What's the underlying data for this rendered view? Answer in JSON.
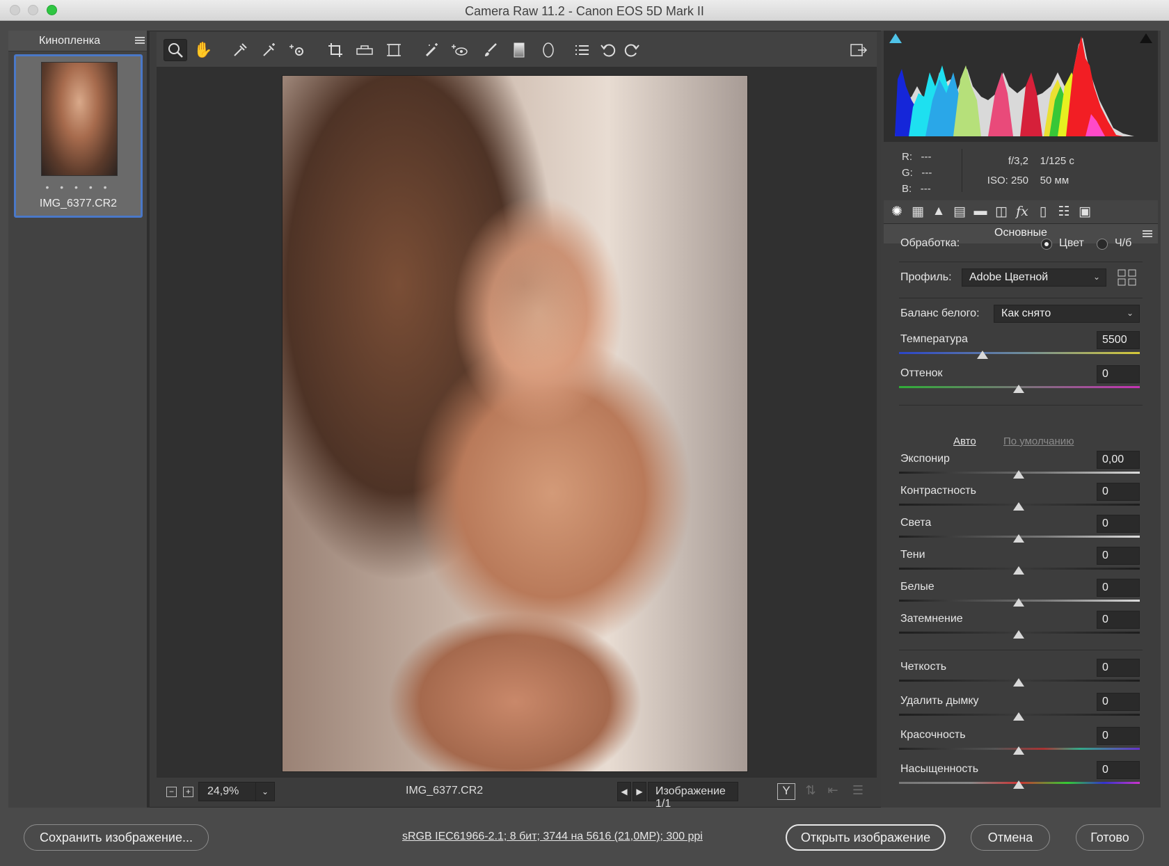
{
  "window": {
    "title": "Camera Raw 11.2  -  Canon EOS 5D Mark II"
  },
  "filmstrip": {
    "title": "Кинопленка",
    "rating_dots": "• • • • •",
    "file_name": "IMG_6377.CR2"
  },
  "toolbar": {
    "tools": [
      "zoom-icon",
      "hand-icon",
      "white-balance-icon",
      "color-sampler-icon",
      "targeted-adjustment-icon",
      "crop-icon",
      "straighten-icon",
      "transform-icon",
      "spot-removal-icon",
      "red-eye-icon",
      "adjustment-brush-icon",
      "graduated-filter-icon",
      "radial-filter-icon",
      "presets-list-icon",
      "rotate-left-icon",
      "rotate-right-icon"
    ],
    "active_tool": "zoom-icon"
  },
  "canvas_bar": {
    "zoom": "24,9%",
    "file_name": "IMG_6377.CR2",
    "image_counter": "Изображение 1/1",
    "before_after_label": "Y"
  },
  "histogram": {
    "r": "R:",
    "r_val": "---",
    "g": "G:",
    "g_val": "---",
    "b": "B:",
    "b_val": "---",
    "aperture": "f/3,2",
    "shutter": "1/125 с",
    "iso": "ISO: 250",
    "focal": "50 мм"
  },
  "panel": {
    "title": "Основные",
    "treatment_label": "Обработка:",
    "treatment_color": "Цвет",
    "treatment_bw": "Ч/б",
    "profile_label": "Профиль:",
    "profile_value": "Adobe Цветной",
    "wb_label": "Баланс белого:",
    "wb_value": "Как снято",
    "auto": "Авто",
    "default": "По умолчанию",
    "sliders": {
      "temperature": {
        "label": "Температура",
        "value": "5500"
      },
      "tint": {
        "label": "Оттенок",
        "value": "0"
      },
      "exposure": {
        "label": "Экспонир",
        "value": "0,00"
      },
      "contrast": {
        "label": "Контрастность",
        "value": "0"
      },
      "highlights": {
        "label": "Света",
        "value": "0"
      },
      "shadows": {
        "label": "Тени",
        "value": "0"
      },
      "whites": {
        "label": "Белые",
        "value": "0"
      },
      "blacks": {
        "label": "Затемнение",
        "value": "0"
      },
      "clarity": {
        "label": "Четкость",
        "value": "0"
      },
      "dehaze": {
        "label": "Удалить дымку",
        "value": "0"
      },
      "vibrance": {
        "label": "Красочность",
        "value": "0"
      },
      "saturation": {
        "label": "Насыщенность",
        "value": "0"
      }
    }
  },
  "footer": {
    "save": "Сохранить изображение...",
    "workflow": "sRGB IEC61966-2.1; 8 бит; 3744 на 5616 (21,0МР); 300 ppi",
    "open": "Открыть изображение",
    "cancel": "Отмена",
    "done": "Готово"
  },
  "colors": {
    "accent": "#4a78c8",
    "background": "#3c3c3c",
    "panel": "#3d3d3d"
  }
}
